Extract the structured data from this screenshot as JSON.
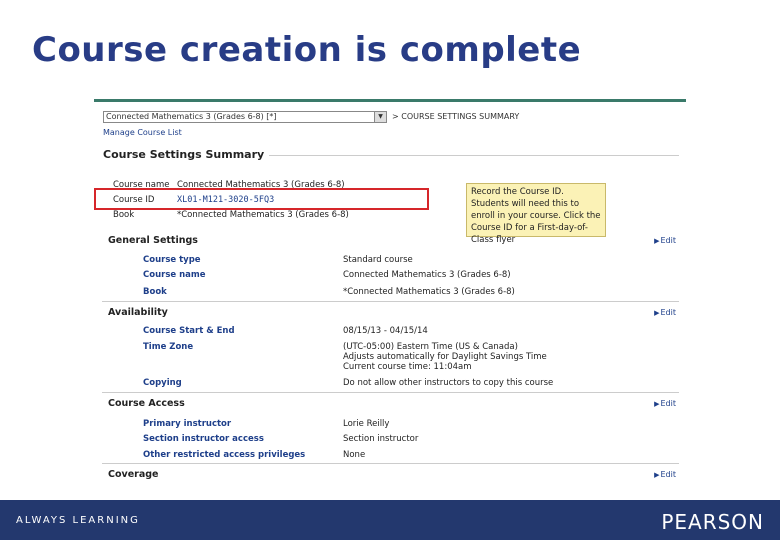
{
  "slide": {
    "title": "Course creation is complete"
  },
  "screenshot": {
    "course_select": "Connected Mathematics 3 (Grades 6-8) [*]",
    "breadcrumb": "> COURSE SETTINGS SUMMARY",
    "manage_link": "Manage Course List",
    "summary_title": "Course Settings Summary",
    "top_rows": [
      {
        "label": "Course name",
        "value": "Connected Mathematics 3 (Grades 6-8)"
      },
      {
        "label": "Course ID",
        "value": "XL01-M121-3020-5FQ3"
      },
      {
        "label": "Book",
        "value": "*Connected Mathematics 3 (Grades 6-8)"
      }
    ],
    "callout": "Record the Course ID. Students will need this to enroll in your course. Click the Course ID for a First-day-of-Class flyer",
    "edit_label": "Edit",
    "sections": {
      "general": {
        "title": "General Settings",
        "rows": [
          {
            "label": "Course type",
            "value": "Standard course"
          },
          {
            "label": "Course name",
            "value": "Connected Mathematics 3 (Grades 6-8)"
          },
          {
            "label": "Book",
            "value": "*Connected Mathematics 3 (Grades 6-8)"
          }
        ]
      },
      "availability": {
        "title": "Availability",
        "rows": [
          {
            "label": "Course Start & End",
            "value": "08/15/13 - 04/15/14"
          },
          {
            "label": "Time Zone",
            "value": "(UTC-05:00) Eastern Time (US & Canada)",
            "value2": "Adjusts automatically for Daylight Savings Time",
            "value3": "Current course time: 11:04am"
          },
          {
            "label": "Copying",
            "value": "Do not allow other instructors to copy this course"
          }
        ]
      },
      "access": {
        "title": "Course Access",
        "rows": [
          {
            "label": "Primary instructor",
            "value": "Lorie Reilly"
          },
          {
            "label": "Section instructor access",
            "value": "Section instructor"
          },
          {
            "label": "Other restricted access privileges",
            "value": "None"
          }
        ]
      },
      "coverage": {
        "title": "Coverage"
      }
    }
  },
  "footer": {
    "tagline": "ALWAYS LEARNING",
    "brand": "PEARSON"
  },
  "colors": {
    "title": "#283c86",
    "footer": "#23386e",
    "highlight": "#d6262a",
    "callout_bg": "#fbf2b6"
  }
}
